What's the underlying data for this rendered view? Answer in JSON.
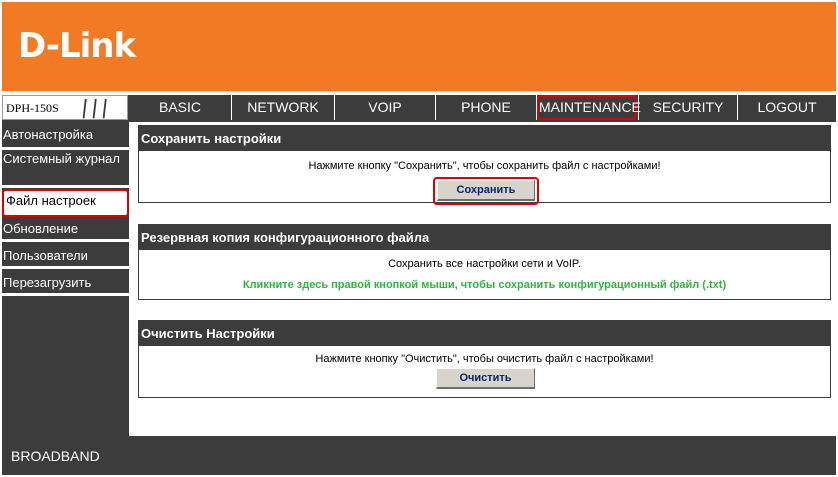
{
  "brand": {
    "logo_text": "D-Link",
    "accent_color": "#f37a25",
    "dark_color": "#3c3c3c"
  },
  "model": {
    "name": "DPH-150S"
  },
  "nav": {
    "tabs": [
      {
        "label": "BASIC"
      },
      {
        "label": "NETWORK"
      },
      {
        "label": "VOIP"
      },
      {
        "label": "PHONE"
      },
      {
        "label": "MAINTENANCE",
        "selected": true
      },
      {
        "label": "SECURITY"
      },
      {
        "label": "LOGOUT"
      }
    ]
  },
  "sidebar": {
    "items": [
      {
        "label": "Автонастройка"
      },
      {
        "label": "Системный журнал"
      },
      {
        "label": "Файл настроек",
        "selected": true
      },
      {
        "label": "Обновление"
      },
      {
        "label": "Пользователи"
      },
      {
        "label": "Перезагрузить"
      }
    ]
  },
  "sections": {
    "save": {
      "title": "Сохранить настройки",
      "text": "Нажмите кнопку \"Сохранить\", чтобы сохранить файл с настройками!",
      "button": "Сохранить"
    },
    "backup": {
      "title": "Резервная копия конфигурационного файла",
      "text": "Сохранить все настройки сети и VoIP.",
      "link": "Кликните здесь правой кнопкой мыши, чтобы сохранить конфигурационный файл (.txt)"
    },
    "clear": {
      "title": "Очистить Настройки",
      "text": "Нажмите кнопку \"Очистить\", чтобы очистить файл с настройками!",
      "button": "Очистить"
    }
  },
  "footer": {
    "text": "BROADBAND"
  }
}
